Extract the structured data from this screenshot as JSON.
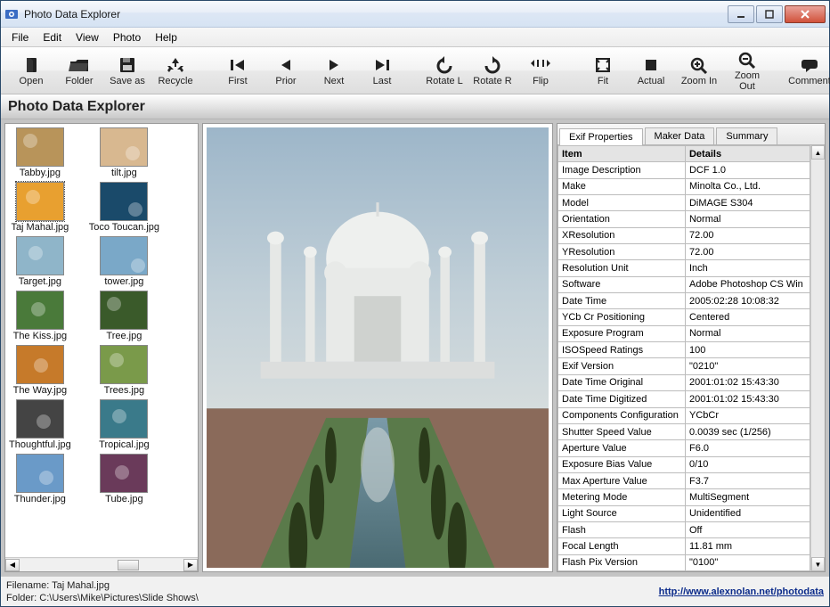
{
  "window": {
    "title": "Photo Data Explorer"
  },
  "menu": {
    "items": [
      "File",
      "Edit",
      "View",
      "Photo",
      "Help"
    ]
  },
  "toolbar": {
    "open": "Open",
    "folder": "Folder",
    "saveas": "Save as",
    "recycle": "Recycle",
    "first": "First",
    "prior": "Prior",
    "next": "Next",
    "last": "Last",
    "rotl": "Rotate L",
    "rotr": "Rotate R",
    "flip": "Flip",
    "fit": "Fit",
    "actual": "Actual",
    "zoomin": "Zoom In",
    "zoomout": "Zoom Out",
    "comment": "Comment"
  },
  "banner": {
    "title": "Photo Data Explorer"
  },
  "thumbs": {
    "col1": [
      {
        "name": "Tabby.jpg"
      },
      {
        "name": "Taj Mahal.jpg"
      },
      {
        "name": "Target.jpg"
      },
      {
        "name": "The Kiss.jpg"
      },
      {
        "name": "The Way.jpg"
      },
      {
        "name": "Thoughtful.jpg"
      },
      {
        "name": "Thunder.jpg"
      }
    ],
    "col2": [
      {
        "name": "tilt.jpg"
      },
      {
        "name": "Toco Toucan.jpg"
      },
      {
        "name": "tower.jpg"
      },
      {
        "name": "Tree.jpg"
      },
      {
        "name": "Trees.jpg"
      },
      {
        "name": "Tropical.jpg"
      },
      {
        "name": "Tube.jpg"
      }
    ]
  },
  "tabs": {
    "exif": "Exif Properties",
    "maker": "Maker Data",
    "summary": "Summary"
  },
  "exif": {
    "header_item": "Item",
    "header_details": "Details",
    "rows": [
      {
        "k": "Image Description",
        "v": "DCF 1.0"
      },
      {
        "k": "Make",
        "v": "Minolta Co., Ltd."
      },
      {
        "k": "Model",
        "v": "DiMAGE S304"
      },
      {
        "k": "Orientation",
        "v": "Normal"
      },
      {
        "k": "XResolution",
        "v": "72.00"
      },
      {
        "k": "YResolution",
        "v": "72.00"
      },
      {
        "k": "Resolution Unit",
        "v": "Inch"
      },
      {
        "k": "Software",
        "v": "Adobe Photoshop CS Win"
      },
      {
        "k": "Date Time",
        "v": "2005:02:28 10:08:32"
      },
      {
        "k": "YCb Cr Positioning",
        "v": "Centered"
      },
      {
        "k": "Exposure Program",
        "v": "Normal"
      },
      {
        "k": "ISOSpeed Ratings",
        "v": "100"
      },
      {
        "k": "Exif Version",
        "v": "\"0210\""
      },
      {
        "k": "Date Time Original",
        "v": "2001:01:02 15:43:30"
      },
      {
        "k": "Date Time Digitized",
        "v": "2001:01:02 15:43:30"
      },
      {
        "k": "Components Configuration",
        "v": "YCbCr"
      },
      {
        "k": "Shutter Speed Value",
        "v": "0.0039 sec (1/256)"
      },
      {
        "k": "Aperture Value",
        "v": "F6.0"
      },
      {
        "k": "Exposure Bias Value",
        "v": "0/10"
      },
      {
        "k": "Max Aperture Value",
        "v": "F3.7"
      },
      {
        "k": "Metering Mode",
        "v": "MultiSegment"
      },
      {
        "k": "Light Source",
        "v": "Unidentified"
      },
      {
        "k": "Flash",
        "v": "Off"
      },
      {
        "k": "Focal Length",
        "v": "11.81 mm"
      },
      {
        "k": "Flash Pix Version",
        "v": "\"0100\""
      }
    ]
  },
  "status": {
    "filename_label": "Filename: ",
    "filename": "Taj Mahal.jpg",
    "folder_label": "Folder: ",
    "folder": "C:\\Users\\Mike\\Pictures\\Slide Shows\\",
    "link": "http://www.alexnolan.net/photodata"
  },
  "colors": {
    "accent": "#2a6ab8"
  }
}
